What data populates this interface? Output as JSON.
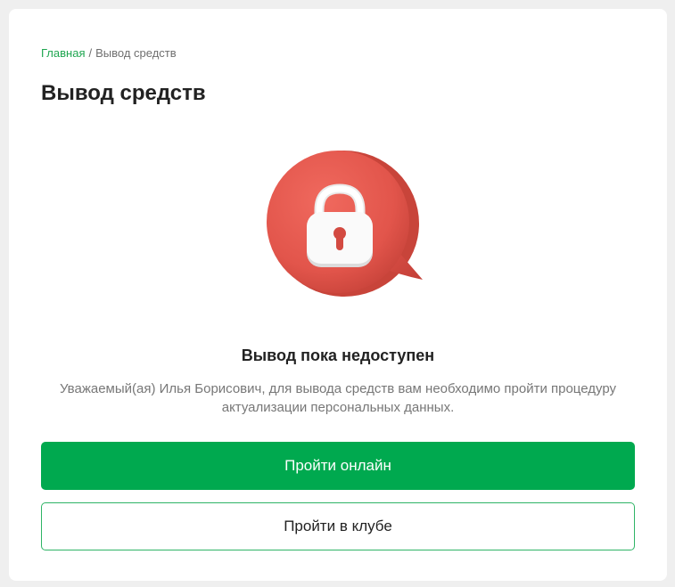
{
  "breadcrumb": {
    "home": "Главная",
    "separator": "/",
    "current": "Вывод средств"
  },
  "page": {
    "title": "Вывод средств"
  },
  "status": {
    "icon": "lock-speech-bubble-icon",
    "icon_color": "#e2554b",
    "title": "Вывод пока недоступен",
    "message": "Уважаемый(ая) Илья Борисович, для вывода средств вам необходимо пройти процедуру актуализации персональных данных."
  },
  "actions": {
    "primary_label": "Пройти онлайн",
    "secondary_label": "Пройти в клубе"
  },
  "colors": {
    "accent": "#00a94f",
    "link": "#1fa650"
  }
}
